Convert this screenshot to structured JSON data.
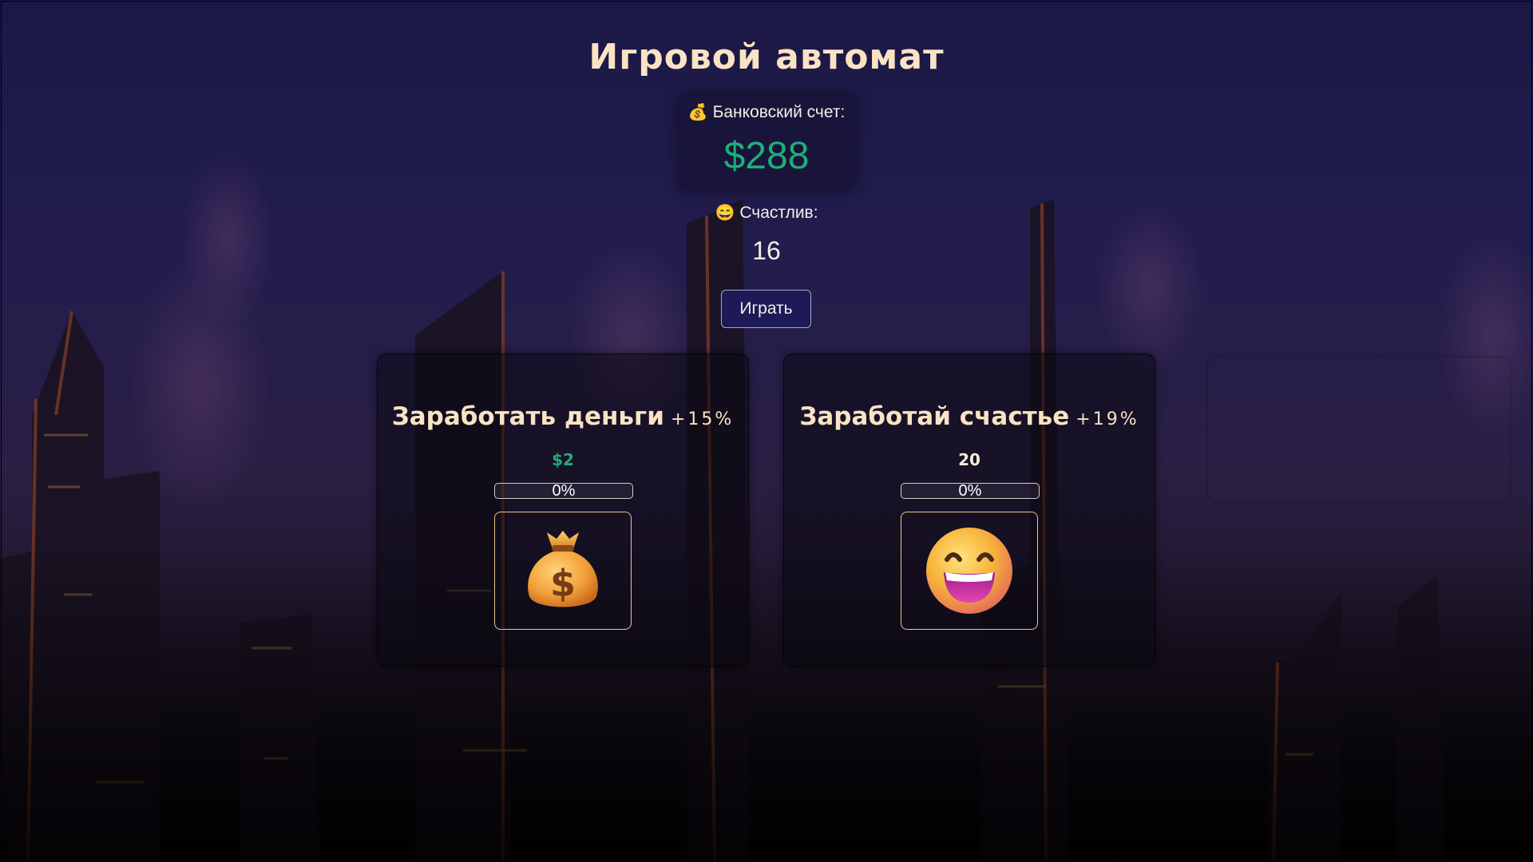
{
  "title": "Игровой автомат",
  "bank": {
    "icon": "money-bag-icon",
    "label": "Банковский счет:",
    "value": "$288"
  },
  "happiness": {
    "icon": "grinning-face-icon",
    "label": "Счастлив:",
    "value": "16"
  },
  "play_button": "Играть",
  "cards": [
    {
      "title": "Заработать деньги",
      "bonus": "+15%",
      "reward": "$2",
      "progress": "0%",
      "progress_value": 0,
      "icon": "money-bag-icon"
    },
    {
      "title": "Заработай счастье",
      "bonus": "+19%",
      "reward": "20",
      "progress": "0%",
      "progress_value": 0,
      "icon": "grinning-face-icon"
    }
  ],
  "colors": {
    "accent_green": "#1fae7a",
    "title_cream": "#fae3c3",
    "button_bg": "#1d1a57",
    "card_border_gold": "#e9c98a"
  }
}
